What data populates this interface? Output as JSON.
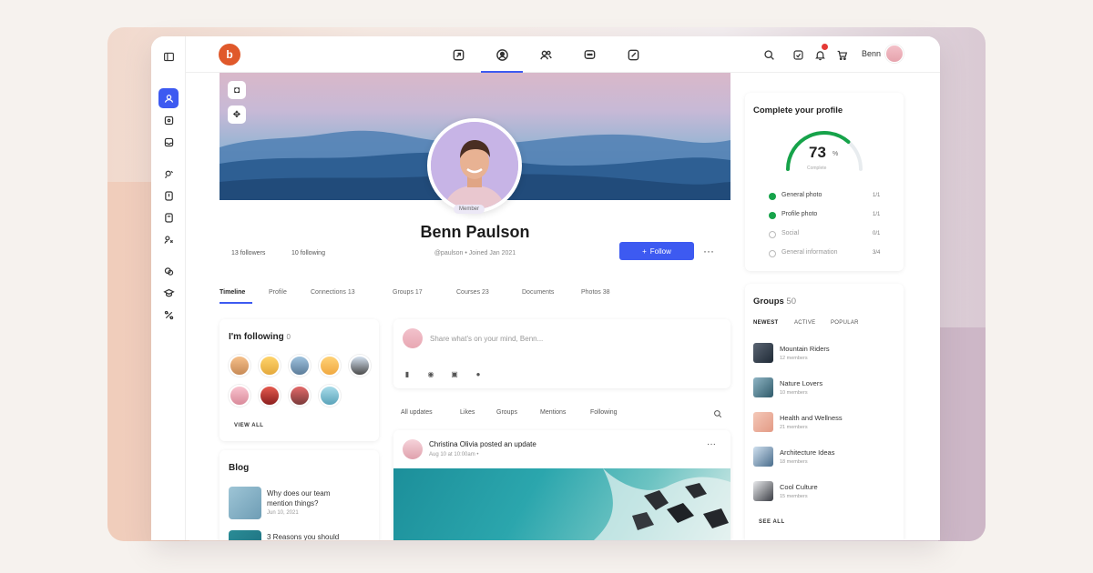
{
  "user": {
    "name": "Benn"
  },
  "profile": {
    "name": "Benn Paulson",
    "badge": "Member",
    "meta": "@paulson  •  Joined Jan 2021",
    "followers": "13 followers",
    "following": "10 following",
    "follow_label": "Follow",
    "more_label": "···"
  },
  "tabs": [
    {
      "label": "Timeline"
    },
    {
      "label": "Profile"
    },
    {
      "label": "Connections   13"
    },
    {
      "label": "Groups   17"
    },
    {
      "label": "Courses   23"
    },
    {
      "label": "Documents"
    },
    {
      "label": "Photos   38"
    }
  ],
  "following_card": {
    "title": "I'm following",
    "count": "0",
    "view_all": "VIEW ALL"
  },
  "blog_card": {
    "title": "Blog",
    "posts": [
      {
        "title": "Why does our team\nmention things?",
        "date": "Jun 10, 2021"
      },
      {
        "title": "3 Reasons you should",
        "date": ""
      }
    ]
  },
  "composer": {
    "placeholder": "Share what's on your mind, Benn..."
  },
  "feed_filters": [
    "All updates",
    "Likes",
    "Groups",
    "Mentions",
    "Following"
  ],
  "post": {
    "author_line": "Christina Olivia posted an update",
    "sub": "Aug 10 at 10:00am  •"
  },
  "complete_profile": {
    "title": "Complete your profile",
    "percent": "73",
    "percent_sign": "%",
    "sub": "Complete",
    "progress_fraction": 0.73,
    "items": [
      {
        "label": "General photo",
        "value": "1/1",
        "done": true
      },
      {
        "label": "Profile photo",
        "value": "1/1",
        "done": true
      },
      {
        "label": "Social",
        "value": "0/1",
        "done": false
      },
      {
        "label": "General information",
        "value": "3/4",
        "done": false
      }
    ]
  },
  "groups": {
    "title": "Groups",
    "count": "50",
    "tabs": [
      "NEWEST",
      "ACTIVE",
      "POPULAR"
    ],
    "items": [
      {
        "name": "Mountain Riders",
        "sub": "12 members"
      },
      {
        "name": "Nature Lovers",
        "sub": "10 members"
      },
      {
        "name": "Health and Wellness",
        "sub": "21 members"
      },
      {
        "name": "Architecture Ideas",
        "sub": "18 members"
      },
      {
        "name": "Cool Culture",
        "sub": "15 members"
      }
    ],
    "see_all": "SEE ALL"
  },
  "colors": {
    "accent": "#3d5af1",
    "logo": "#e0592b",
    "success": "#16a34a"
  }
}
